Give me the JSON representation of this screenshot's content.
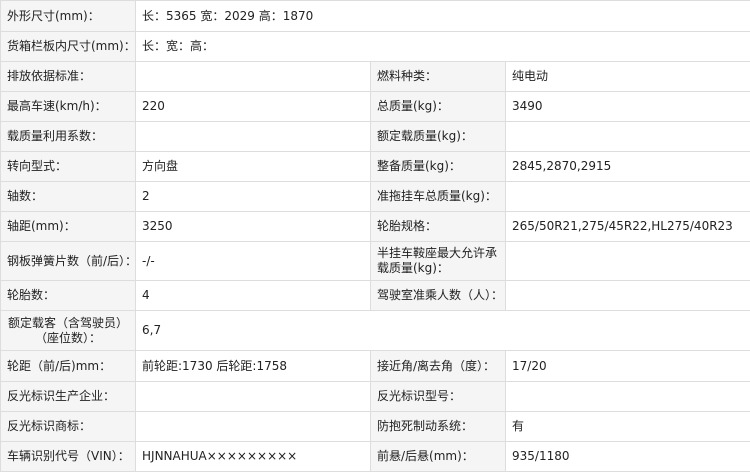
{
  "rows": [
    {
      "label": "外形尺寸(mm)：",
      "value": "长：5365 宽：2029 高：1870"
    },
    {
      "label": "货箱栏板内尺寸(mm)：",
      "value": "长：宽：高："
    },
    {
      "label": "排放依据标准：",
      "value": "",
      "label2": "燃料种类：",
      "value2": "纯电动"
    },
    {
      "label": "最高车速(km/h)：",
      "value": "220",
      "label2": "总质量(kg)：",
      "value2": "3490"
    },
    {
      "label": "载质量利用系数：",
      "value": "",
      "label2": "额定载质量(kg)：",
      "value2": ""
    },
    {
      "label": "转向型式：",
      "value": "方向盘",
      "label2": "整备质量(kg)：",
      "value2": "2845,2870,2915"
    },
    {
      "label": "轴数：",
      "value": "2",
      "label2": "准拖挂车总质量(kg)：",
      "value2": ""
    },
    {
      "label": "轴距(mm)：",
      "value": "3250",
      "label2": "轮胎规格：",
      "value2": "265/50R21,275/45R22,HL275/40R23"
    },
    {
      "label": "钢板弹簧片数（前/后）：",
      "value": "-/-",
      "label2": "半挂车鞍座最大允许承载质量(kg)：",
      "value2": ""
    },
    {
      "label": "轮胎数：",
      "value": "4",
      "label2": "驾驶室准乘人数（人）：",
      "value2": ""
    },
    {
      "label": "额定载客（含驾驶员）（座位数）：",
      "value": "6,7"
    },
    {
      "label": "轮距（前/后)mm：",
      "value": "前轮距:1730 后轮距:1758",
      "label2": "接近角/离去角（度）：",
      "value2": "17/20"
    },
    {
      "label": "反光标识生产企业：",
      "value": "",
      "label2": "反光标识型号：",
      "value2": ""
    },
    {
      "label": "反光标识商标：",
      "value": "",
      "label2": "防抱死制动系统：",
      "value2": "有"
    },
    {
      "label": "车辆识别代号（VIN）：",
      "value": "HJNNAHUA×××××××××",
      "label2": "前悬/后悬(mm)：",
      "value2": "935/1180"
    }
  ]
}
